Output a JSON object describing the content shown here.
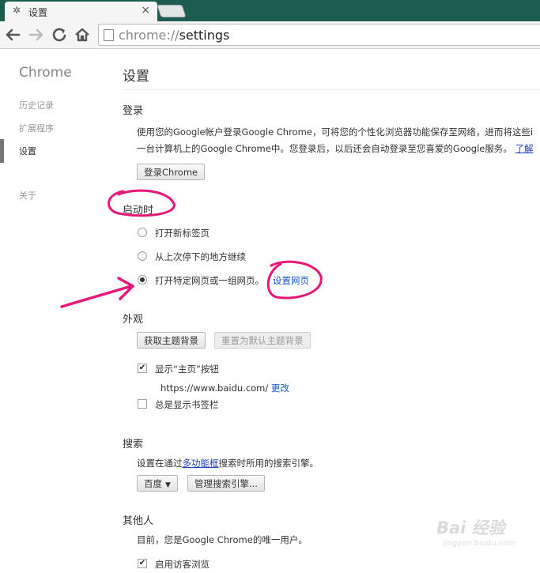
{
  "tab": {
    "title": "设置",
    "icon": "gear-icon",
    "close_glyph": "×"
  },
  "address": {
    "scheme": "chrome://",
    "path": "settings"
  },
  "sidebar": {
    "brand": "Chrome",
    "items": [
      {
        "label": "历史记录"
      },
      {
        "label": "扩展程序"
      },
      {
        "label": "设置"
      },
      {
        "label": "关于"
      }
    ]
  },
  "main": {
    "title": "设置",
    "signin": {
      "heading": "登录",
      "desc_line1": "使用您的Google帐户登录Google Chrome，可将您的个性化浏览器功能保存至网络，进而将这些i",
      "desc_line2": "一台计算机上的Google Chrome中。您登录后，以后还会自动登录至您喜爱的Google服务。",
      "learn_more": "了解",
      "button": "登录Chrome"
    },
    "startup": {
      "heading": "启动时",
      "options": [
        {
          "label": "打开新标签页",
          "selected": false
        },
        {
          "label": "从上次停下的地方继续",
          "selected": false
        },
        {
          "label": "打开特定网页或一组网页。",
          "selected": true
        }
      ],
      "set_pages": "设置网页"
    },
    "appearance": {
      "heading": "外观",
      "get_themes": "获取主题背景",
      "reset_theme": "重置为默认主题背景",
      "show_home": "显示“主页”按钮",
      "home_url": "https://www.baidu.com/",
      "change": "更改",
      "bookmarks_bar": "总是显示书签栏"
    },
    "search": {
      "heading": "搜索",
      "desc_prefix": "设置在通过",
      "omnibox_link": "多功能框",
      "desc_suffix": "搜索时所用的搜索引擎。",
      "engine": "百度",
      "manage": "管理搜索引擎..."
    },
    "users": {
      "heading": "其他人",
      "desc": "目前，您是Google Chrome的唯一用户。",
      "guest": "启用访客浏览"
    }
  },
  "watermark": {
    "text": "Bai 经验",
    "sub": "jingyan.baidu.com"
  },
  "colors": {
    "annotation": "#e8177a",
    "tabstrip": "#1d5d4f",
    "link": "#1a55cc"
  }
}
